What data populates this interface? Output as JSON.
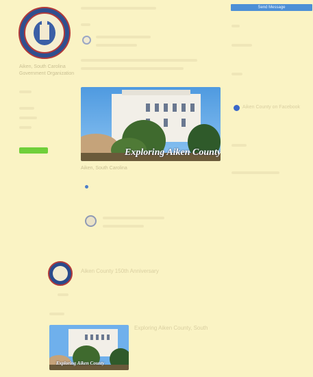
{
  "header": {
    "top_button_label": "Send Message",
    "seal_logo": "county seal logo"
  },
  "left_sidebar": {
    "text_lines": [
      "Aiken, South Carolina",
      "Government Organization"
    ],
    "green_tag_label": "Send a Page"
  },
  "post": {
    "photo_caption": "Exploring Aiken County",
    "photo_subcaption": "Aiken, South Carolina"
  },
  "anniversary": {
    "title": "Aiken County 150th Anniversary"
  },
  "second_photo": {
    "caption": "Exploring Aiken County",
    "side_text": "Exploring Aiken County, South"
  },
  "right_sidebar": {
    "facebook_label": "Aiken County on Facebook"
  },
  "colors": {
    "background": "#faf3c4",
    "button_blue": "#4d8fd6",
    "green": "#6fcf3a",
    "seal_blue": "#2f4f8f",
    "seal_red": "#b23a3a"
  },
  "icons": [
    "county-seal-icon",
    "facebook-icon",
    "globe-icon",
    "anniversary-seal-icon"
  ]
}
